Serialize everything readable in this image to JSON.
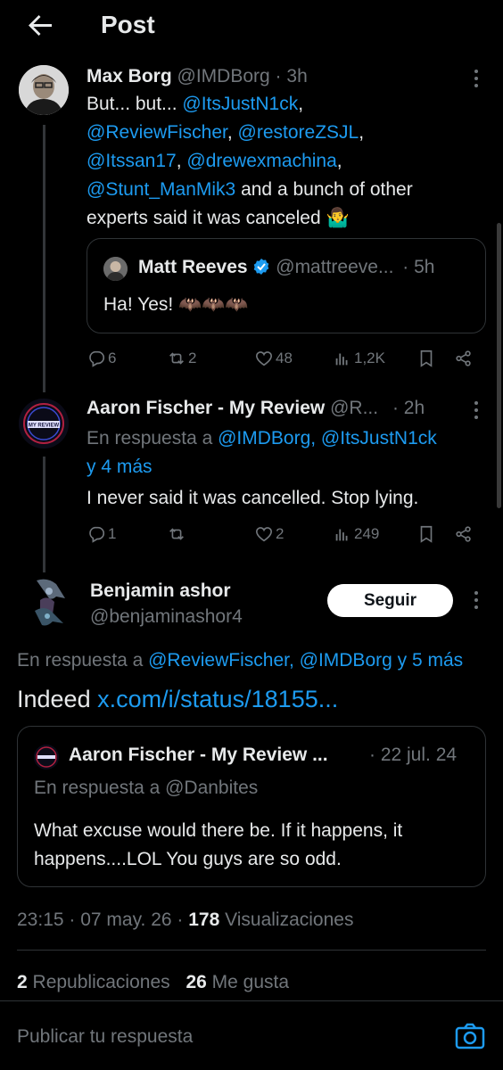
{
  "header": {
    "title": "Post",
    "back_icon": "arrow-left-icon"
  },
  "tweet1": {
    "name": "Max Borg",
    "handle": "@IMDBorg",
    "sep": "·",
    "time": "3h",
    "text_plain_1": "But... but... ",
    "mention_1": "@ItsJustN1ck",
    "comma_1": ",",
    "mention_2": "@ReviewFischer",
    "comma_2": ", ",
    "mention_3": "@restoreZSJL",
    "comma_3": ",",
    "mention_4": "@Itssan17",
    "comma_4": ", ",
    "mention_5": "@drewexmachina",
    "comma_5": ",",
    "mention_6": "@Stunt_ManMik3",
    "text_plain_2": " and a bunch of other",
    "text_plain_3": "experts said it was canceled 🤷‍♂️",
    "quote": {
      "name": "Matt Reeves",
      "handle": "@mattreeve...",
      "time": "· 5h",
      "text": "Ha!  Yes!  🦇🦇🦇"
    },
    "actions": {
      "replies": "6",
      "reposts": "2",
      "likes": "48",
      "views": "1,2K"
    }
  },
  "tweet2": {
    "name": "Aaron Fischer - My Review",
    "handle": "@R...",
    "time": "· 2h",
    "reply_to_prefix": "En respuesta a ",
    "reply_to_1": "@IMDBorg, @ItsJustN1ck",
    "reply_to_2": "y 4 más",
    "text": "I never said it was cancelled. Stop lying.",
    "actions": {
      "replies": "1",
      "reposts": "",
      "likes": "2",
      "views": "249"
    }
  },
  "main": {
    "name": "Benjamin ashor",
    "handle": "@benjaminashor4",
    "follow_label": "Seguir",
    "reply_to_prefix": "En respuesta a ",
    "reply_to": "@ReviewFischer, @IMDBorg y 5 más",
    "text_plain": "Indeed ",
    "link": "x.com/i/status/18155...",
    "quote": {
      "name": "Aaron Fischer - My Review ...",
      "time": "· 22 jul. 24",
      "reply_to": "En respuesta a @Danbites",
      "text_1": "What excuse would there be. If it happens, it",
      "text_2": "happens....LOL You guys are so odd."
    },
    "timestamp": "23:15 · 07 may. 26 · ",
    "views_count": "178",
    "views_label": " Visualizaciones",
    "reposts_count": "2",
    "reposts_label": " Republicaciones",
    "likes_count": "26",
    "likes_label": " Me gusta"
  },
  "reply_bar": {
    "placeholder": "Publicar tu respuesta",
    "camera_icon": "camera-icon"
  },
  "colors": {
    "accent": "#1d9bf0",
    "muted": "#71767b",
    "text": "#e7e9ea",
    "bg": "#000000"
  }
}
